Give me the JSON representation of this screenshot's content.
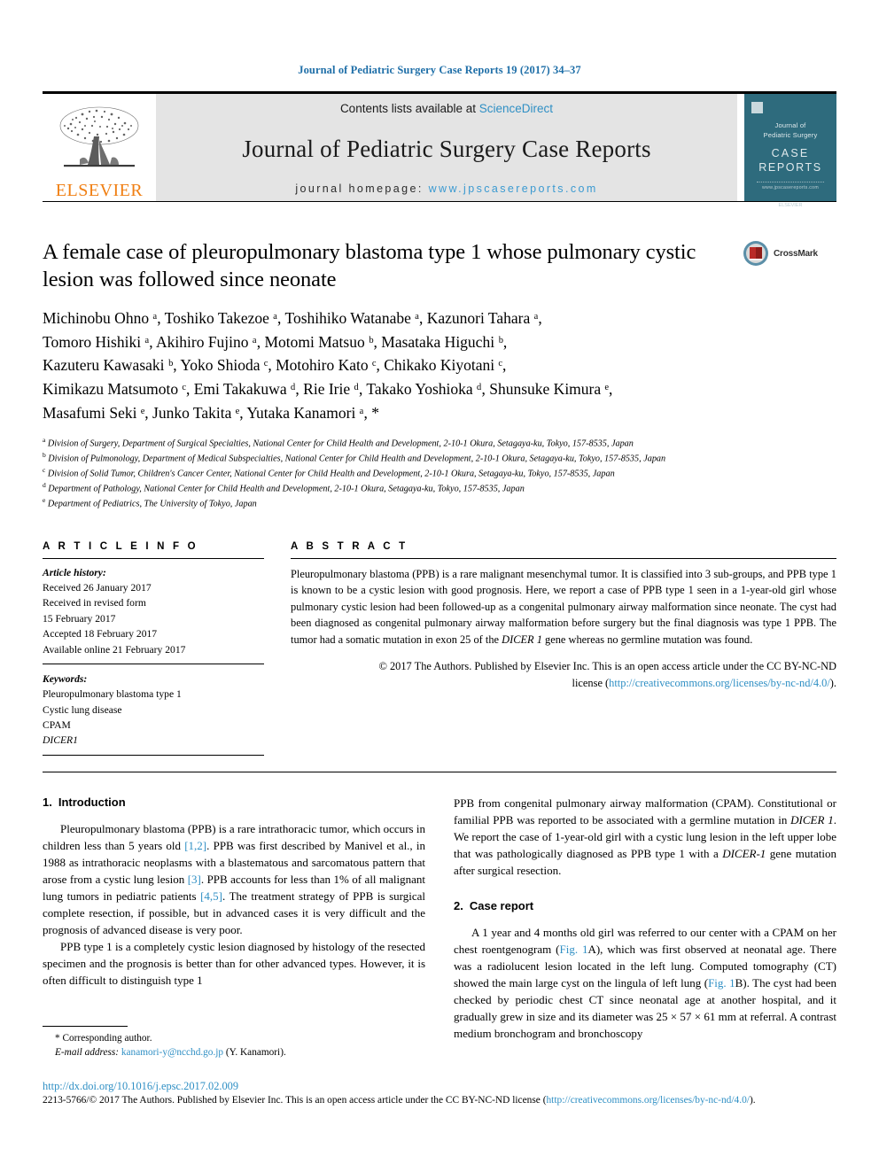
{
  "running_head": "Journal of Pediatric Surgery Case Reports 19 (2017) 34–37",
  "masthead": {
    "publisher_logo_text": "ELSEVIER",
    "contents_prefix": "Contents lists available at ",
    "contents_link": "ScienceDirect",
    "journal_name": "Journal of Pediatric Surgery Case Reports",
    "homepage_prefix": "journal homepage: ",
    "homepage_url": "www.jpscasereports.com",
    "cover": {
      "journal_title_line1": "Journal of",
      "journal_title_line2": "Pediatric Surgery",
      "case": "CASE",
      "reports": "REPORTS",
      "subtitle": "www.jpscasereports.com",
      "publisher": "ELSEVIER"
    }
  },
  "article": {
    "title": "A female case of pleuropulmonary blastoma type 1 whose pulmonary cystic lesion was followed since neonate",
    "crossmark_label": "CrossMark",
    "authors_lines": [
      "Michinobu Ohno ᵃ, Toshiko Takezoe ᵃ, Toshihiko Watanabe ᵃ, Kazunori Tahara ᵃ,",
      "Tomoro Hishiki ᵃ, Akihiro Fujino ᵃ, Motomi Matsuo ᵇ, Masataka Higuchi ᵇ,",
      "Kazuteru Kawasaki ᵇ, Yoko Shioda ᶜ, Motohiro Kato ᶜ, Chikako Kiyotani ᶜ,",
      "Kimikazu Matsumoto ᶜ, Emi Takakuwa ᵈ, Rie Irie ᵈ, Takako Yoshioka ᵈ, Shunsuke Kimura ᵉ,",
      "Masafumi Seki ᵉ, Junko Takita ᵉ, Yutaka Kanamori ᵃ, *"
    ],
    "affiliations": [
      {
        "mark": "a",
        "text": "Division of Surgery, Department of Surgical Specialties, National Center for Child Health and Development, 2-10-1 Okura, Setagaya-ku, Tokyo, 157-8535, Japan"
      },
      {
        "mark": "b",
        "text": "Division of Pulmonology, Department of Medical Subspecialties, National Center for Child Health and Development, 2-10-1 Okura, Setagaya-ku, Tokyo, 157-8535, Japan"
      },
      {
        "mark": "c",
        "text": "Division of Solid Tumor, Children's Cancer Center, National Center for Child Health and Development, 2-10-1 Okura, Setagaya-ku, Tokyo, 157-8535, Japan"
      },
      {
        "mark": "d",
        "text": "Department of Pathology, National Center for Child Health and Development, 2-10-1 Okura, Setagaya-ku, Tokyo, 157-8535, Japan"
      },
      {
        "mark": "e",
        "text": "Department of Pediatrics, The University of Tokyo, Japan"
      }
    ]
  },
  "article_info": {
    "heading": "A R T I C L E   I N F O",
    "history_label": "Article history:",
    "history": [
      "Received 26 January 2017",
      "Received in revised form",
      "15 February 2017",
      "Accepted 18 February 2017",
      "Available online 21 February 2017"
    ],
    "keywords_label": "Keywords:",
    "keywords": [
      "Pleuropulmonary blastoma type 1",
      "Cystic lung disease",
      "CPAM",
      "DICER1"
    ]
  },
  "abstract": {
    "heading": "A B S T R A C T",
    "text_parts": [
      "Pleuropulmonary blastoma (PPB) is a rare malignant mesenchymal tumor. It is classified into 3 sub-groups, and PPB type 1 is known to be a cystic lesion with good prognosis. Here, we report a case of PPB type 1 seen in a 1-year-old girl whose pulmonary cystic lesion had been followed-up as a congenital pulmonary airway malformation since neonate. The cyst had been diagnosed as congenital pulmonary airway malformation before surgery but the final diagnosis was type 1 PPB. The tumor had a somatic mutation in exon 25 of the ",
      "DICER 1",
      " gene whereas no germline mutation was found."
    ],
    "copyright_line1": "© 2017 The Authors. Published by Elsevier Inc. This is an open access article under the CC BY-NC-ND",
    "copyright_line2_prefix": "license (",
    "copyright_link": "http://creativecommons.org/licenses/by-nc-nd/4.0/",
    "copyright_line2_suffix": ")."
  },
  "sections": {
    "intro": {
      "number": "1.",
      "title": "Introduction",
      "paragraph1_parts": [
        "Pleuropulmonary blastoma (PPB) is a rare intrathoracic tumor, which occurs in children less than 5 years old ",
        "[1,2]",
        ". PPB was first described by Manivel et al., in 1988 as intrathoracic neoplasms with a blastematous and sarcomatous pattern that arose from a cystic lung lesion ",
        "[3]",
        ". PPB accounts for less than 1% of all malignant lung tumors in pediatric patients ",
        "[4,5]",
        ". The treatment strategy of PPB is surgical complete resection, if possible, but in advanced cases it is very difficult and the prognosis of advanced disease is very poor."
      ],
      "paragraph2": "PPB type 1 is a completely cystic lesion diagnosed by histology of the resected specimen and the prognosis is better than for other advanced types. However, it is often difficult to distinguish type 1",
      "paragraph2_cont_parts": [
        "PPB from congenital pulmonary airway malformation (CPAM). Constitutional or familial PPB was reported to be associated with a germline mutation in ",
        "DICER 1",
        ". We report the case of 1-year-old girl with a cystic lung lesion in the left upper lobe that was pathologically diagnosed as PPB type 1 with a ",
        "DICER-1",
        " gene mutation after surgical resection."
      ]
    },
    "case_report": {
      "number": "2.",
      "title": "Case report",
      "paragraph_parts": [
        "A 1 year and 4 months old girl was referred to our center with a CPAM on her chest roentgenogram (",
        "Fig. 1",
        "A), which was first observed at neonatal age. There was a radiolucent lesion located in the left lung. Computed tomography (CT) showed the main large cyst on the lingula of left lung (",
        "Fig. 1",
        "B). The cyst had been checked by periodic chest CT since neonatal age at another hospital, and it gradually grew in size and its diameter was 25 × 57 × 61 mm at referral. A contrast medium bronchogram and bronchoscopy"
      ]
    }
  },
  "footnote": {
    "corresponding_marker": "*",
    "corresponding_label": "Corresponding author.",
    "email_label": "E-mail address:",
    "email": "kanamori-y@ncchd.go.jp",
    "email_owner": "(Y. Kanamori)."
  },
  "page_footer": {
    "doi": "http://dx.doi.org/10.1016/j.epsc.2017.02.009",
    "issn_prefix": "2213-5766/© 2017 The Authors. Published by Elsevier Inc. This is an open access article under the CC BY-NC-ND license (",
    "issn_link": "http://creativecommons.org/licenses/by-nc-nd/4.0/",
    "issn_suffix": ")."
  },
  "colors": {
    "link": "#2f8fc4",
    "running_head": "#1f6fa8",
    "elsevier_orange": "#f07f13",
    "cover_teal": "#2e6b7d",
    "band_gray": "#e4e4e4"
  }
}
